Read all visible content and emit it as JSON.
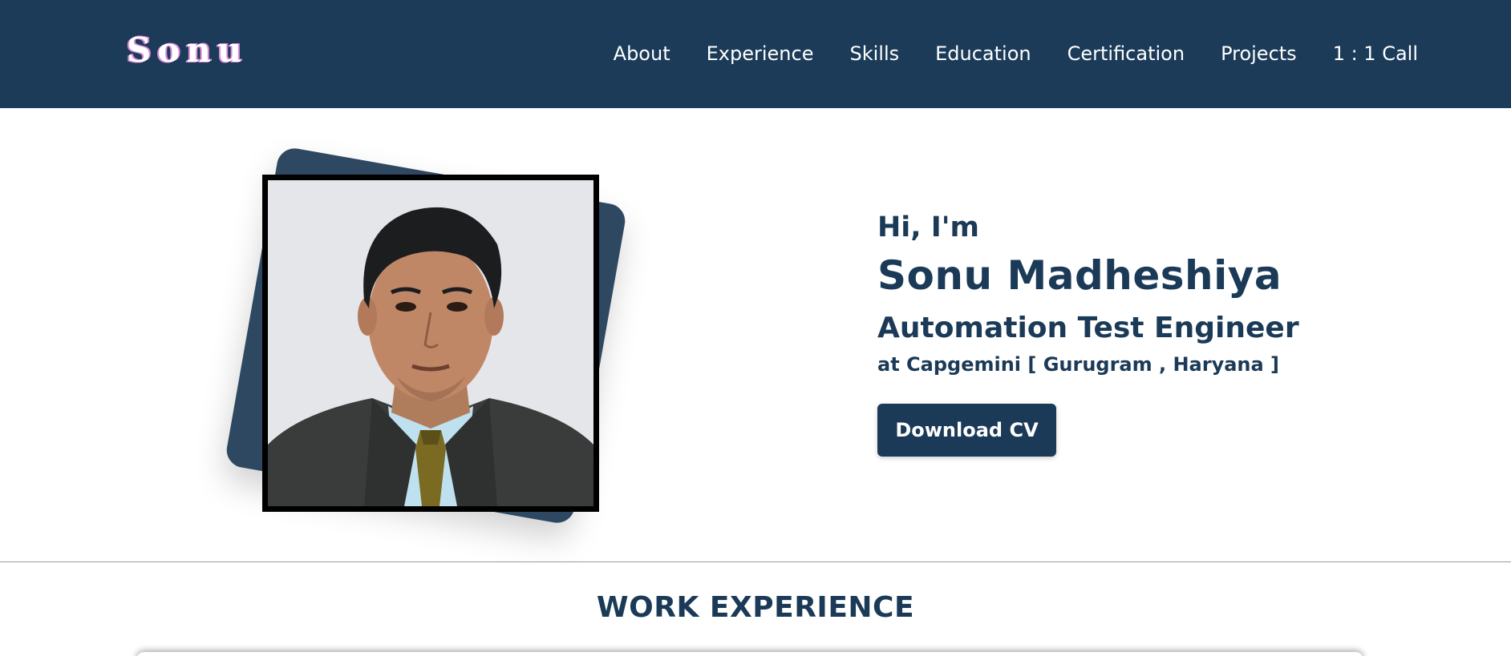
{
  "header": {
    "logo": "Sonu",
    "nav": [
      "About",
      "Experience",
      "Skills",
      "Education",
      "Certification",
      "Projects",
      "1 : 1 Call"
    ]
  },
  "hero": {
    "greeting": "Hi, I'm",
    "name": "Sonu Madheshiya",
    "role": "Automation Test Engineer",
    "company": "at Capgemini [ Gurugram , Haryana ]",
    "cv_button": "Download CV"
  },
  "sections": {
    "work_title": "WORK EXPERIENCE"
  },
  "colors": {
    "navbar": "#1b3b58",
    "primary": "#1b3a57",
    "photo_backing": "#2e4862",
    "logo_shadow": "#d98ad8"
  }
}
